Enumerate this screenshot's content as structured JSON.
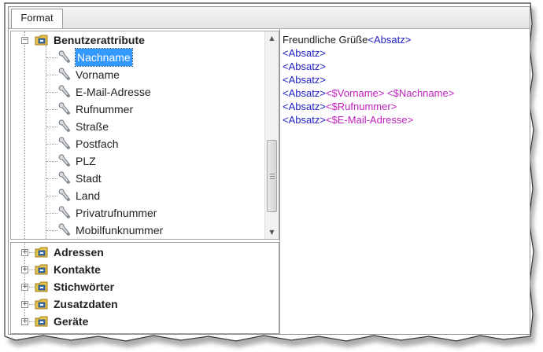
{
  "tabs": [
    {
      "label": "Format"
    }
  ],
  "tree_top": {
    "root": {
      "label": "Benutzerattribute",
      "expander": "−"
    },
    "items": [
      {
        "label": "Nachname",
        "selected": true
      },
      {
        "label": "Vorname"
      },
      {
        "label": "E-Mail-Adresse"
      },
      {
        "label": "Rufnummer"
      },
      {
        "label": "Straße"
      },
      {
        "label": "Postfach"
      },
      {
        "label": "PLZ"
      },
      {
        "label": "Stadt"
      },
      {
        "label": "Land"
      },
      {
        "label": "Privatrufnummer"
      },
      {
        "label": "Mobilfunknummer"
      }
    ],
    "scroll_up_glyph": "▲",
    "scroll_down_glyph": "▼"
  },
  "tree_bottom": {
    "items": [
      {
        "label": "Adressen",
        "expander": "+"
      },
      {
        "label": "Kontakte",
        "expander": "+"
      },
      {
        "label": "Stichwörter",
        "expander": "+"
      },
      {
        "label": "Zusatzdaten",
        "expander": "+"
      },
      {
        "label": "Geräte",
        "expander": "+"
      }
    ]
  },
  "editor": {
    "lines": [
      [
        {
          "text": "Freundliche Grüße",
          "kind": "plain"
        },
        {
          "text": "<Absatz>",
          "kind": "tag-blue"
        }
      ],
      [
        {
          "text": "<Absatz>",
          "kind": "tag-blue"
        }
      ],
      [
        {
          "text": "<Absatz>",
          "kind": "tag-blue"
        }
      ],
      [
        {
          "text": "<Absatz>",
          "kind": "tag-blue"
        }
      ],
      [
        {
          "text": "<Absatz>",
          "kind": "tag-blue"
        },
        {
          "text": "<$Vorname>",
          "kind": "tag-magenta"
        },
        {
          "text": " ",
          "kind": "plain"
        },
        {
          "text": "<$Nachname>",
          "kind": "tag-magenta"
        }
      ],
      [
        {
          "text": "<Absatz>",
          "kind": "tag-blue"
        },
        {
          "text": "<$Rufnummer>",
          "kind": "tag-magenta"
        }
      ],
      [
        {
          "text": "<Absatz>",
          "kind": "tag-blue"
        },
        {
          "text": "<$E-Mail-Adresse>",
          "kind": "tag-magenta"
        }
      ]
    ]
  },
  "icons": {
    "folder": "folder-icon",
    "field": "wrench-icon"
  },
  "colors": {
    "tag_blue": "#2020c8",
    "tag_magenta": "#c020c0",
    "selection": "#3399ff",
    "folder_yellow": "#e8c44a"
  }
}
